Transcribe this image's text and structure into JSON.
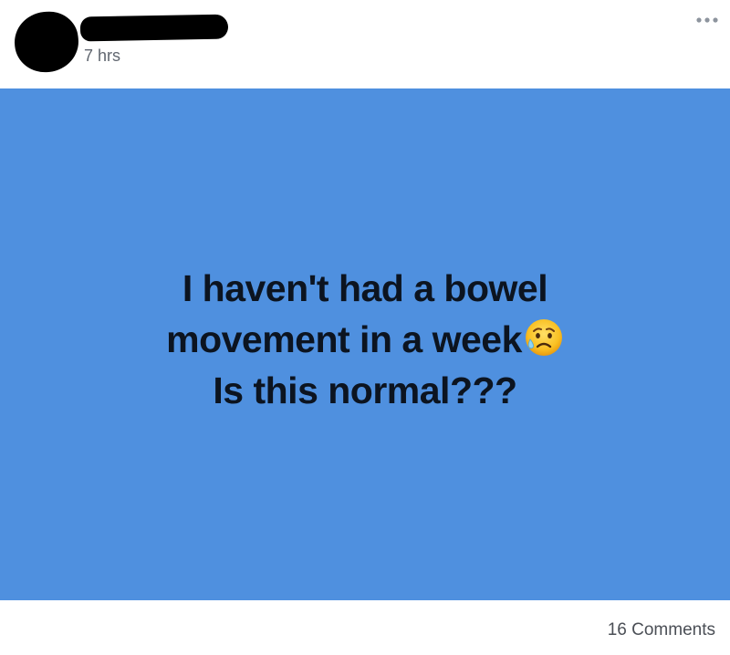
{
  "post": {
    "timestamp": "7 hrs",
    "more_icon": "more-options-icon",
    "card_color": "#4f90df",
    "status_lines": [
      "I haven't had a bowel",
      "movement in a week",
      "Is this normal???"
    ],
    "emoji": "sad-but-relieved-face-icon",
    "comments_label": "16 Comments"
  }
}
